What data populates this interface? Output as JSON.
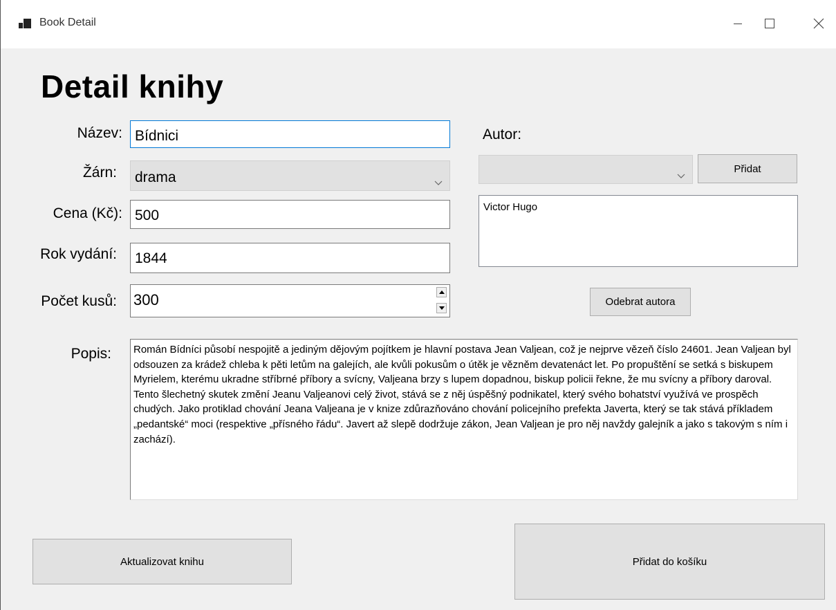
{
  "window": {
    "title": "Book Detail",
    "app_icon": "app-icon",
    "controls": [
      "minimize-icon",
      "maximize-icon",
      "close-icon"
    ]
  },
  "form": {
    "heading": "Detail knihy",
    "nazev": {
      "label": "Název:",
      "value": "Bídnici"
    },
    "zanr": {
      "label": "Žárn:",
      "value": "drama"
    },
    "cena": {
      "label": "Cena (Kč):",
      "value": "500"
    },
    "rok": {
      "label": "Rok vydání:",
      "value": "1844"
    },
    "pocet": {
      "label": "Počet kusů:",
      "value": "300"
    },
    "popis": {
      "label": "Popis:",
      "value": "Román Bídníci působí nespojitě a jediným dějovým pojítkem je hlavní postava Jean Valjean, což je nejprve vězeň číslo 24601. Jean Valjean byl odsouzen za krádež chleba k pěti letům na galejích, ale kvůli pokusům o útěk je vězněm devatenáct let. Po propuštění se setká s biskupem Myrielem, kterému ukradne stříbrné příbory a svícny, Valjeana brzy s lupem dopadnou, biskup policii řekne, že mu svícny a příbory daroval. Tento šlechetný skutek změní Jeanu Valjeanovi celý život, stává se z něj úspěšný podnikatel, který svého bohatství využívá ve prospěch chudých. Jako protiklad chování Jeana Valjeana je v knize zdůrazňováno chování policejního prefekta Javerta, který se tak stává příkladem „pedantské“ moci (respektive „přísného řádu“. Javert až slepě dodržuje zákon, Jean Valjean je pro něj navždy galejník a jako s takovým s ním i zachází)."
    }
  },
  "authors": {
    "label": "Autor:",
    "combo_value": "",
    "add_button": "Přidat",
    "list": [
      "Victor Hugo"
    ],
    "remove_button": "Odebrat autora"
  },
  "actions": {
    "update_button": "Aktualizovat knihu",
    "cart_button": "Přidat do košíku"
  }
}
